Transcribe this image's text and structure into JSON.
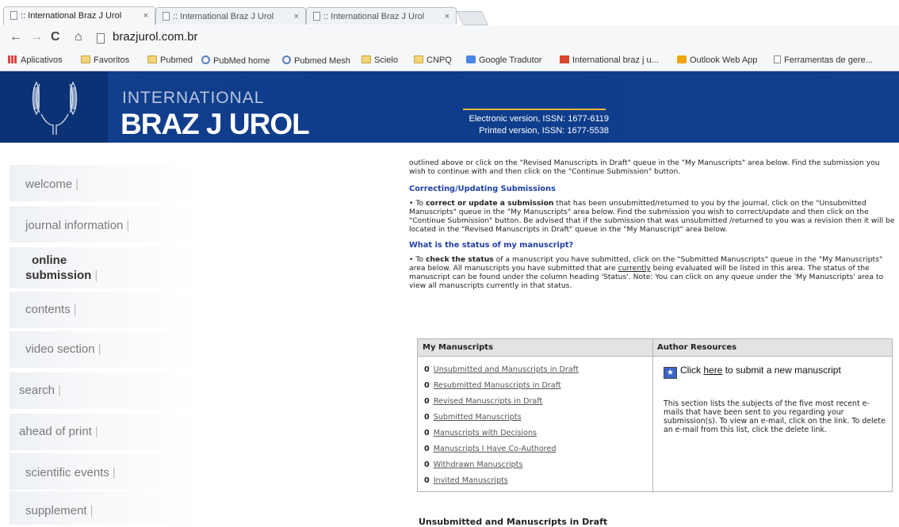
{
  "browser": {
    "tabs": [
      {
        "label": ":: International Braz J Urol",
        "active": true
      },
      {
        "label": ":: International Braz J Urol",
        "active": false
      },
      {
        "label": ":: International Braz J Urol",
        "active": false
      }
    ],
    "tab_close": "×",
    "address": "brazjurol.com.br",
    "bookmarks": [
      {
        "label": "Aplicativos",
        "icon": "apps-icon"
      },
      {
        "label": "Favoritos",
        "icon": "folder-icon"
      },
      {
        "label": "Pubmed",
        "icon": "folder-icon"
      },
      {
        "label": "PubMed home",
        "icon": "pubmed-icon"
      },
      {
        "label": "Pubmed Mesh",
        "icon": "pubmed-icon"
      },
      {
        "label": "Scielo",
        "icon": "folder-icon"
      },
      {
        "label": "CNPQ",
        "icon": "folder-icon"
      },
      {
        "label": "Google Tradutor",
        "icon": "translate-icon"
      },
      {
        "label": "International braz j u...",
        "icon": "ibju-icon"
      },
      {
        "label": "Outlook Web App",
        "icon": "outlook-icon"
      },
      {
        "label": "Ferramentas de gere...",
        "icon": "page-icon"
      }
    ]
  },
  "header": {
    "brand_small": "INTERNATIONAL",
    "brand_big": "BRAZ J UROL",
    "issn_electronic": "Electronic version, ISSN: 1677-6119",
    "issn_printed": "Printed version, ISSN: 1677-5538",
    "colors": {
      "banner": "#0d3c8a",
      "accent": "#e8b83a"
    }
  },
  "nav": {
    "items": [
      {
        "label": "welcome"
      },
      {
        "label": "journal information"
      },
      {
        "label": "online submission",
        "line1": "online",
        "line2": "submission",
        "active": true
      },
      {
        "label": "contents"
      },
      {
        "label": "video section"
      },
      {
        "label": "search"
      },
      {
        "label": "ahead of print"
      },
      {
        "label": "scientific events"
      },
      {
        "label": "supplement"
      }
    ],
    "separator": "|"
  },
  "content": {
    "intro": "outlined above or click on the \"Revised Manuscripts in Draft\" queue in the \"My Manuscripts\" area below. Find the submission you wish to continue with and then click on the \"Continue Submission\" button.",
    "correcting_title": "Correcting/Updating Submissions",
    "correcting_pre": "• To ",
    "correcting_bold": "correct or update a submission",
    "correcting_post": " that has been unsubmitted/returned to you by the journal, click on the \"Unsubmitted Manuscripts\" queue in the \"My Manuscripts\" area below. Find the submission you wish to correct/update and then click on the \"Continue Submission\" button. Be advised that if the submission that was unsubmitted /returned to you was a revision then it will be located in the \"Revised Manuscripts in Draft\" queue in the \"My Manuscript\" area below.",
    "status_title": "What is the status of my manuscript?",
    "status_pre": "• To ",
    "status_bold": "check the status",
    "status_mid": " of a manuscript you have submitted, click on the \"Submitted Manuscripts\" queue in the \"My Manuscripts\" area below. All manuscripts you have submitted that are ",
    "status_underline": "currently",
    "status_post": " being evaluated will be listed in this area. The status of the manuscript can be found under the column heading 'Status'. Note: You can click on any queue under the 'My Manuscripts' area to view all manuscripts currently in that status."
  },
  "manuscripts": {
    "heading": "My Manuscripts",
    "queues": [
      {
        "count": "0",
        "label": "Unsubmitted and Manuscripts in Draft"
      },
      {
        "count": "0",
        "label": "Resubmitted Manuscripts in Draft"
      },
      {
        "count": "0",
        "label": "Revised Manuscripts in Draft"
      },
      {
        "count": "0",
        "label": "Submitted Manuscripts"
      },
      {
        "count": "0",
        "label": "Manuscripts with Decisions"
      },
      {
        "count": "0",
        "label": "Manuscripts I Have Co-Authored"
      },
      {
        "count": "0",
        "label": "Withdrawn Manuscripts"
      },
      {
        "count": "0",
        "label": "Invited Manuscripts"
      }
    ]
  },
  "author_resources": {
    "heading": "Author Resources",
    "submit_pre": "Click ",
    "submit_link": "here",
    "submit_post": " to submit a new manuscript",
    "email_text": "This section lists the subjects of the five most recent e-mails that have been sent to you regarding your submission(s). To view an e-mail, click on the link. To delete an e-mail from this list, click the delete link."
  },
  "bottom_heading": "Unsubmitted and Manuscripts in Draft"
}
